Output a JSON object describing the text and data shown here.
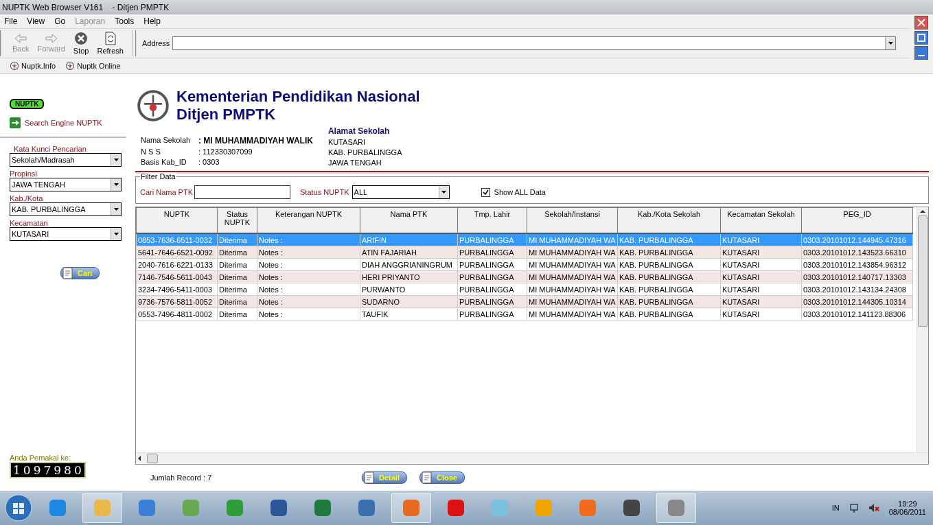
{
  "window": {
    "title": "NUPTK Web Browser V161    - Ditjen PMPTK"
  },
  "menu": [
    {
      "label": "File",
      "disabled": false
    },
    {
      "label": "View",
      "disabled": false
    },
    {
      "label": "Go",
      "disabled": false
    },
    {
      "label": "Laporan",
      "disabled": true
    },
    {
      "label": "Tools",
      "disabled": false
    },
    {
      "label": "Help",
      "disabled": false
    }
  ],
  "toolbar": [
    {
      "kind": "back",
      "label": "Back",
      "disabled": true
    },
    {
      "kind": "forward",
      "label": "Forward",
      "disabled": true
    },
    {
      "kind": "stop",
      "label": "Stop",
      "disabled": false
    },
    {
      "kind": "refresh",
      "label": "Refresh",
      "disabled": false
    }
  ],
  "address": {
    "label": "Address"
  },
  "links": [
    "Nuptk.Info",
    "Nuptk Online"
  ],
  "sidebar": {
    "logo": "NUPTK",
    "heading": "Search Engine NUPTK",
    "fields": [
      {
        "label": "Kata Kunci Pencarian",
        "value": "Sekolah/Madrasah"
      },
      {
        "label": "Propinsi",
        "value": "JAWA TENGAH"
      },
      {
        "label": "Kab./Kota",
        "value": "KAB. PURBALINGGA"
      },
      {
        "label": "Kecamatan",
        "value": "KUTASARI"
      }
    ],
    "search_button": "Cari",
    "visitor_label": "Anda Pemakai ke:",
    "visitor_count": "1097980"
  },
  "header": {
    "title_line_1": "Kementerian Pendidikan Nasional",
    "title_line_2": "Ditjen PMPTK",
    "info": [
      {
        "label": "Nama Sekolah",
        "value": ": MI MUHAMMADIYAH WALIK",
        "bold": true
      },
      {
        "label": "N S S",
        "value": ": 112330307099",
        "bold": false
      },
      {
        "label": "Basis Kab_ID",
        "value": ": 0303",
        "bold": false
      }
    ],
    "address_title": "Alamat Sekolah",
    "address_lines": [
      "KUTASARI",
      "KAB. PURBALINGGA",
      "JAWA TENGAH"
    ]
  },
  "filter": {
    "legend": "Filter Data",
    "name_label": "Cari Nama PTK",
    "status_label": "Status NUPTK",
    "status_value": "ALL",
    "show_all_label": "Show ALL Data",
    "show_all_checked": true
  },
  "table": {
    "columns": [
      "NUPTK",
      "Status NUPTK",
      "Keterangan NUPTK",
      "Nama PTK",
      "Tmp. Lahir",
      "Sekolah/Instansi",
      "Kab./Kota Sekolah",
      "Kecamatan Sekolah",
      "PEG_ID"
    ],
    "rows": [
      {
        "selected": true,
        "cells": [
          "0853-7636-6511-0032",
          "Diterima",
          "Notes :",
          "ARIFIN",
          "PURBALINGGA",
          "MI MUHAMMADIYAH WA",
          "KAB. PURBALINGGA",
          "KUTASARI",
          "0303.20101012.144945.47316"
        ]
      },
      {
        "selected": false,
        "cells": [
          "5641-7646-6521-0092",
          "Diterima",
          "Notes :",
          "ATIN FAJARIAH",
          "PURBALINGGA",
          "MI MUHAMMADIYAH WA",
          "KAB. PURBALINGGA",
          "KUTASARI",
          "0303.20101012.143523.66310"
        ]
      },
      {
        "selected": false,
        "cells": [
          "2040-7616-6221-0133",
          "Diterima",
          "Notes :",
          "DIAH ANGGRIANINGRUM",
          "PURBALINGGA",
          "MI MUHAMMADIYAH WA",
          "KAB. PURBALINGGA",
          "KUTASARI",
          "0303.20101012.143854.96312"
        ]
      },
      {
        "selected": false,
        "cells": [
          "7146-7546-5611-0043",
          "Diterima",
          "Notes :",
          "HERI PRIYANTO",
          "PURBALINGGA",
          "MI MUHAMMADIYAH WA",
          "KAB. PURBALINGGA",
          "KUTASARI",
          "0303.20101012.140717.13303"
        ]
      },
      {
        "selected": false,
        "cells": [
          "3234-7496-5411-0003",
          "Diterima",
          "Notes :",
          "PURWANTO",
          "PURBALINGGA",
          "MI MUHAMMADIYAH WA",
          "KAB. PURBALINGGA",
          "KUTASARI",
          "0303.20101012.143134.24308"
        ]
      },
      {
        "selected": false,
        "cells": [
          "9736-7576-5811-0052",
          "Diterima",
          "Notes :",
          "SUDARNO",
          "PURBALINGGA",
          "MI MUHAMMADIYAH WA",
          "KAB. PURBALINGGA",
          "KUTASARI",
          "0303.20101012.144305.10314"
        ]
      },
      {
        "selected": false,
        "cells": [
          "0553-7496-4811-0002",
          "Diterima",
          "Notes :",
          "TAUFIK",
          "PURBALINGGA",
          "MI MUHAMMADIYAH WA",
          "KAB. PURBALINGGA",
          "KUTASARI",
          "0303.20101012.141123.88306"
        ]
      }
    ]
  },
  "footer": {
    "record_count": "Jumlah Record : 7",
    "buttons": [
      "Detail",
      "Close"
    ]
  },
  "taskbar": {
    "language": "IN",
    "time": "19:29",
    "date": "08/06/2011"
  }
}
